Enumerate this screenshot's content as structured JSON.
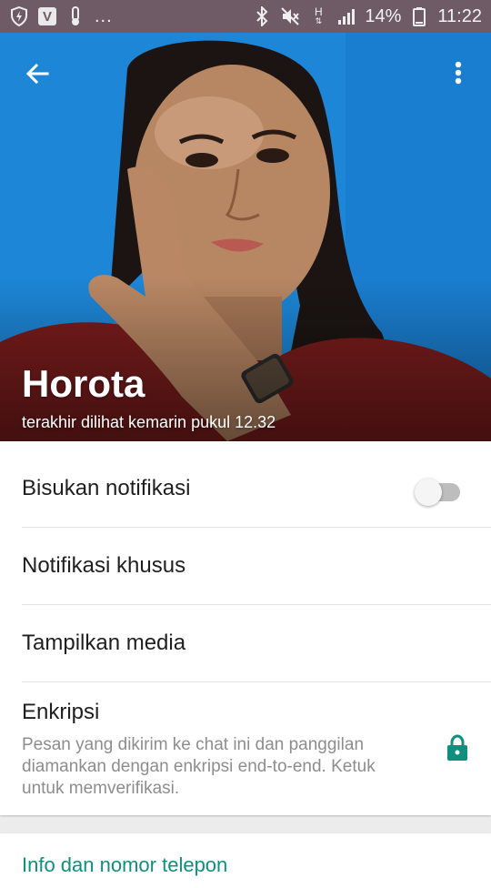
{
  "status_bar": {
    "left_icons": [
      "shield-icon",
      "v-app-icon",
      "thermometer-icon"
    ],
    "app_badge": "V",
    "overflow": "...",
    "right_icons": [
      "bluetooth-icon",
      "mute-icon",
      "network-h-icon",
      "signal-icon",
      "battery-icon"
    ],
    "network_label": "H",
    "battery": "14%",
    "time": "11:22"
  },
  "header": {
    "back_icon": "arrow-back-icon",
    "menu_icon": "more-vert-icon",
    "name": "Horota",
    "last_seen": "terakhir dilihat kemarin pukul 12.32"
  },
  "settings": {
    "mute_label": "Bisukan notifikasi",
    "mute_enabled": false,
    "custom_notif_label": "Notifikasi khusus",
    "media_label": "Tampilkan media",
    "encryption": {
      "title": "Enkripsi",
      "description": "Pesan yang dikirim ke chat ini dan panggilan diamankan dengan enkripsi end-to-end. Ketuk untuk memverifikasi.",
      "icon": "lock-icon"
    }
  },
  "info": {
    "title": "Info dan nomor telepon"
  },
  "colors": {
    "status_bar": "#6f5b66",
    "accent_teal": "#0f8f7e",
    "photo_background": "#1d86d6"
  }
}
